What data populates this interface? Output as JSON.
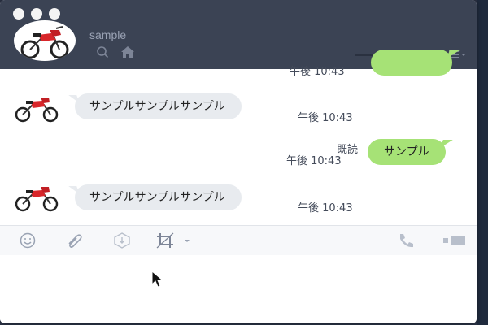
{
  "window": {
    "contact_name": "sample"
  },
  "messages": [
    {
      "direction": "incoming",
      "text": "サンプルサンプルサンプル",
      "time": "午後 10:43"
    },
    {
      "direction": "outgoing",
      "text": "サンプル",
      "read": "既読",
      "time": "午後 10:43"
    },
    {
      "direction": "incoming",
      "text": "サンプルサンプルサンプル",
      "time": "午後 10:43"
    }
  ],
  "partial_top": {
    "time": "午後 10:43"
  },
  "toolbar": {
    "icons": [
      "emoji-icon",
      "attach-icon",
      "keep-icon",
      "crop-icon",
      "call-icon",
      "video-icon"
    ]
  },
  "input": {
    "value": ""
  },
  "colors": {
    "header": "#3b4354",
    "incoming_bubble": "#e8ebef",
    "outgoing_bubble": "#a6e276",
    "toolbar": "#f7f8fa"
  }
}
